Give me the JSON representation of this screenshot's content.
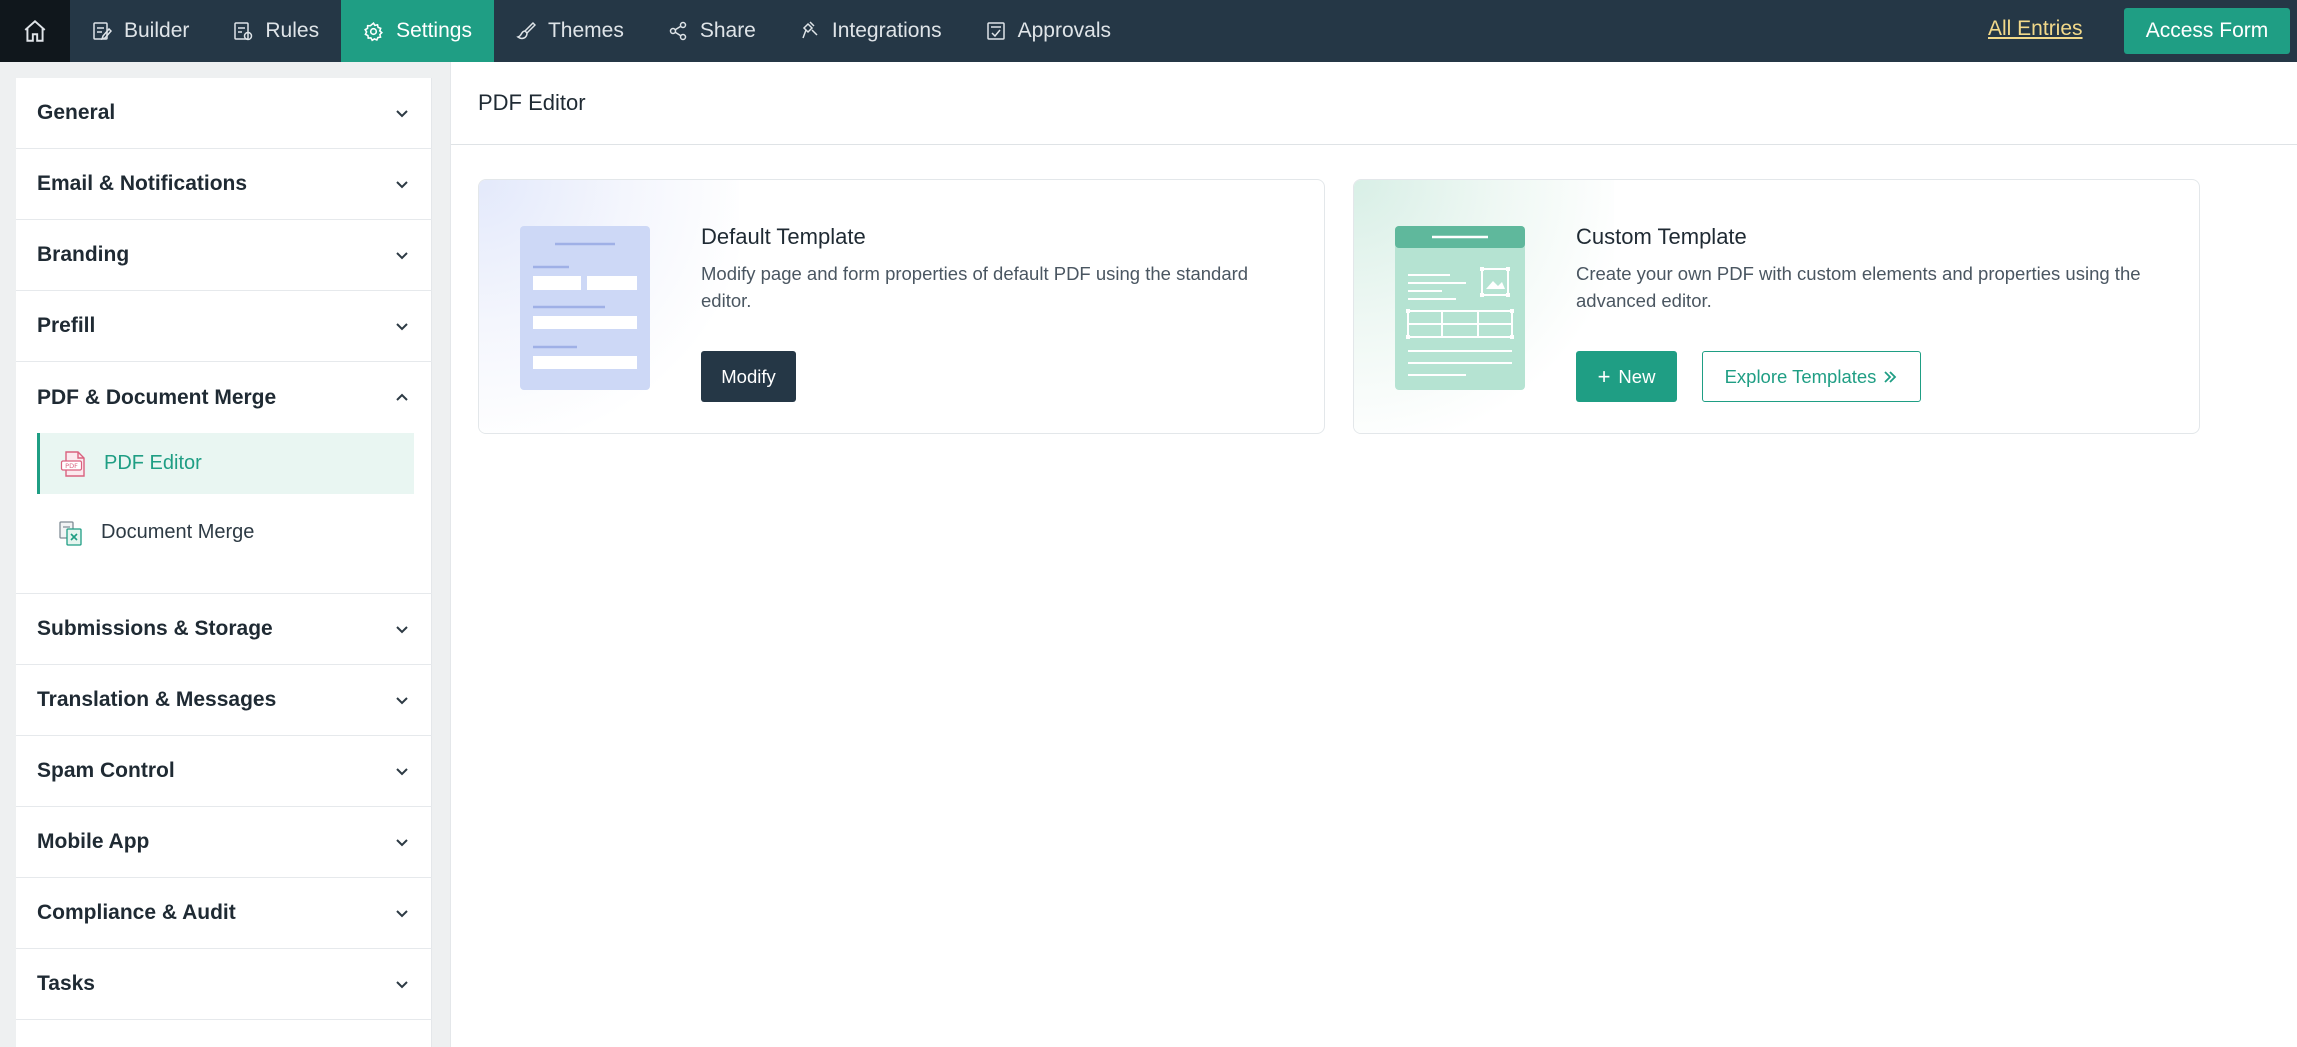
{
  "nav": {
    "items": [
      {
        "label": "Builder",
        "icon": "builder-icon"
      },
      {
        "label": "Rules",
        "icon": "rules-icon"
      },
      {
        "label": "Settings",
        "icon": "gear-icon",
        "active": true
      },
      {
        "label": "Themes",
        "icon": "brush-icon"
      },
      {
        "label": "Share",
        "icon": "share-icon"
      },
      {
        "label": "Integrations",
        "icon": "plug-icon"
      },
      {
        "label": "Approvals",
        "icon": "approvals-icon"
      }
    ],
    "all_entries": "All Entries",
    "access_form": "Access Form"
  },
  "sidebar": {
    "sections": [
      {
        "label": "General",
        "expanded": false
      },
      {
        "label": "Email & Notifications",
        "expanded": false
      },
      {
        "label": "Branding",
        "expanded": false
      },
      {
        "label": "Prefill",
        "expanded": false
      },
      {
        "label": "PDF & Document Merge",
        "expanded": true
      },
      {
        "label": "Submissions & Storage",
        "expanded": false
      },
      {
        "label": "Translation & Messages",
        "expanded": false
      },
      {
        "label": "Spam Control",
        "expanded": false
      },
      {
        "label": "Mobile App",
        "expanded": false
      },
      {
        "label": "Compliance & Audit",
        "expanded": false
      },
      {
        "label": "Tasks",
        "expanded": false
      }
    ],
    "sub_items": [
      {
        "label": "PDF Editor",
        "icon": "pdf-icon",
        "active": true,
        "icon_text": "PDF"
      },
      {
        "label": "Document Merge",
        "icon": "document-merge-icon",
        "active": false
      }
    ]
  },
  "main": {
    "title": "PDF Editor",
    "cards": [
      {
        "title": "Default Template",
        "description": "Modify page and form properties of default PDF using the standard editor.",
        "button": "Modify"
      },
      {
        "title": "Custom Template",
        "description": "Create your own PDF with custom elements and properties using the advanced editor.",
        "button_new": "New",
        "button_explore": "Explore Templates"
      }
    ]
  },
  "colors": {
    "topbar": "#253746",
    "accent": "#1f9e84",
    "link": "#f2d98a"
  }
}
